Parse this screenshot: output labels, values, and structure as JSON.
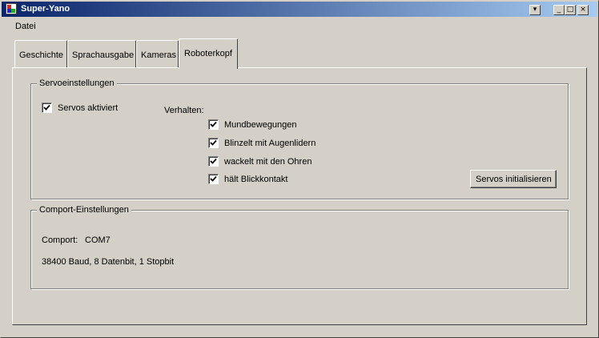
{
  "window": {
    "title": "Super-Yano",
    "buttons": {
      "dropdown": "▾",
      "minimize": "_",
      "maximize": "□",
      "close": "×"
    }
  },
  "menu": {
    "items": [
      "Datei"
    ]
  },
  "tabs": [
    {
      "label": "Geschichte"
    },
    {
      "label": "Sprachausgabe"
    },
    {
      "label": "Kameras"
    },
    {
      "label": "Roboterkopf",
      "active": true
    }
  ],
  "servo_group": {
    "title": "Servoeinstellungen",
    "servos_active": {
      "label": "Servos aktiviert",
      "checked": true
    },
    "behavior_label": "Verhalten:",
    "behaviors": [
      {
        "label": "Mundbewegungen",
        "checked": true
      },
      {
        "label": "Blinzelt mit Augenlidern",
        "checked": true
      },
      {
        "label": "wackelt mit den Ohren",
        "checked": true
      },
      {
        "label": "hält Blickkontakt",
        "checked": true
      }
    ],
    "init_button": "Servos initialisieren"
  },
  "comport_group": {
    "title": "Comport-Einstellungen",
    "comport_label": "Comport:",
    "comport_value": "COM7",
    "settings_text": "38400 Baud, 8 Datenbit, 1 Stopbit"
  }
}
